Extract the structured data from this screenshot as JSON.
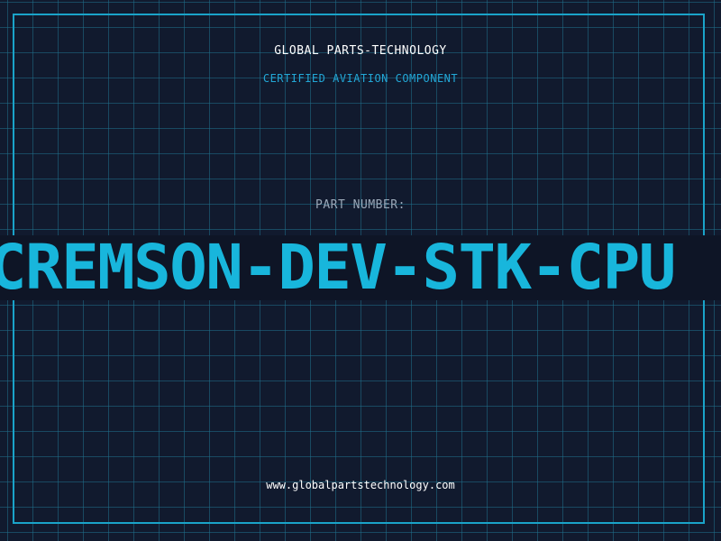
{
  "header": {
    "company": "GLOBAL PARTS-TECHNOLOGY",
    "subtitle": "CERTIFIED AVIATION COMPONENT"
  },
  "part": {
    "label": "PART NUMBER:",
    "number": "CREMSON-DEV-STK-CPU"
  },
  "footer": {
    "website": "www.globalpartstechnology.com"
  },
  "colors": {
    "background": "#111a2e",
    "grid": "#1f6f8b",
    "accent": "#18b6dc",
    "label": "#9aa8b8",
    "text": "#ffffff"
  }
}
